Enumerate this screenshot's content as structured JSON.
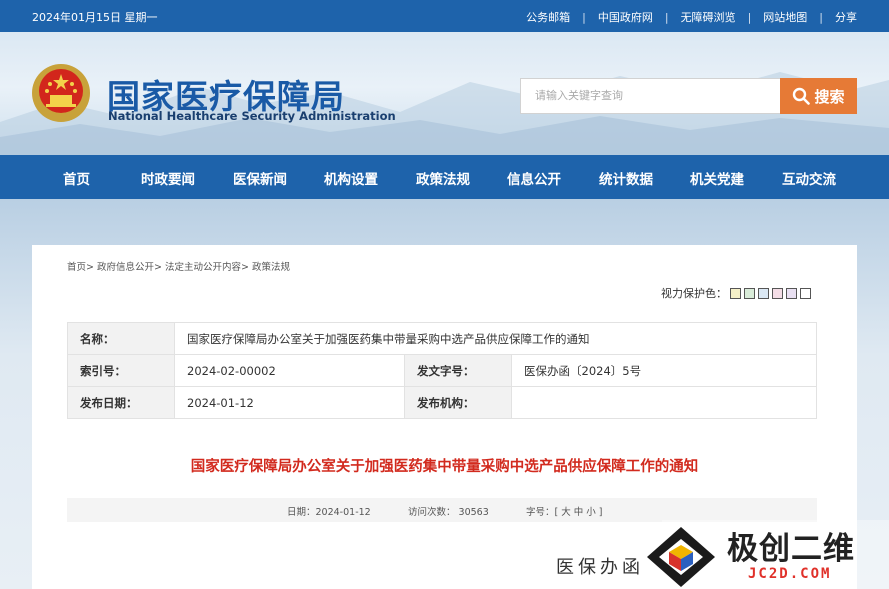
{
  "topbar": {
    "date": "2024年01月15日 星期一",
    "links": [
      "公务邮箱",
      "中国政府网",
      "无障碍浏览",
      "网站地图",
      "分享"
    ],
    "separator": "|"
  },
  "header": {
    "logo_cn": "国家医疗保障局",
    "logo_en": "National Healthcare Security Administration",
    "search_placeholder": "请输入关键字查询",
    "search_button": "搜索"
  },
  "nav": {
    "items": [
      "首页",
      "时政要闻",
      "医保新闻",
      "机构设置",
      "政策法规",
      "信息公开",
      "统计数据",
      "机关党建",
      "互动交流"
    ]
  },
  "breadcrumb": [
    "首页>",
    "政府信息公开>",
    "法定主动公开内容>",
    "政策法规"
  ],
  "eye_protection": {
    "label": "视力保护色：",
    "colors": [
      "#f5f0c8",
      "#d9ecd9",
      "#dbe8f4",
      "#f4dde6",
      "#e9e0f2",
      "#ffffff"
    ]
  },
  "meta": {
    "name_label": "名称：",
    "name_value": "国家医疗保障局办公室关于加强医药集中带量采购中选产品供应保障工作的通知",
    "index_label": "索引号：",
    "index_value": "2024-02-00002",
    "docno_label": "发文字号：",
    "docno_value": "医保办函〔2024〕5号",
    "date_label": "发布日期：",
    "date_value": "2024-01-12",
    "org_label": "发布机构：",
    "org_value": ""
  },
  "article": {
    "title": "国家医疗保障局办公室关于加强医药集中带量采购中选产品供应保障工作的通知",
    "date_text": "日期：2024-01-12",
    "visits_text": "访问次数：  30563",
    "fontsize_text": "字号：[ 大 中 小 ]",
    "preview_text": "医保办函"
  },
  "watermark": {
    "cn": "极创二维",
    "en": "JC2D.COM"
  },
  "colors": {
    "brand_blue": "#1e63ab",
    "search_orange": "#e67a36",
    "title_red": "#d22a1e"
  }
}
